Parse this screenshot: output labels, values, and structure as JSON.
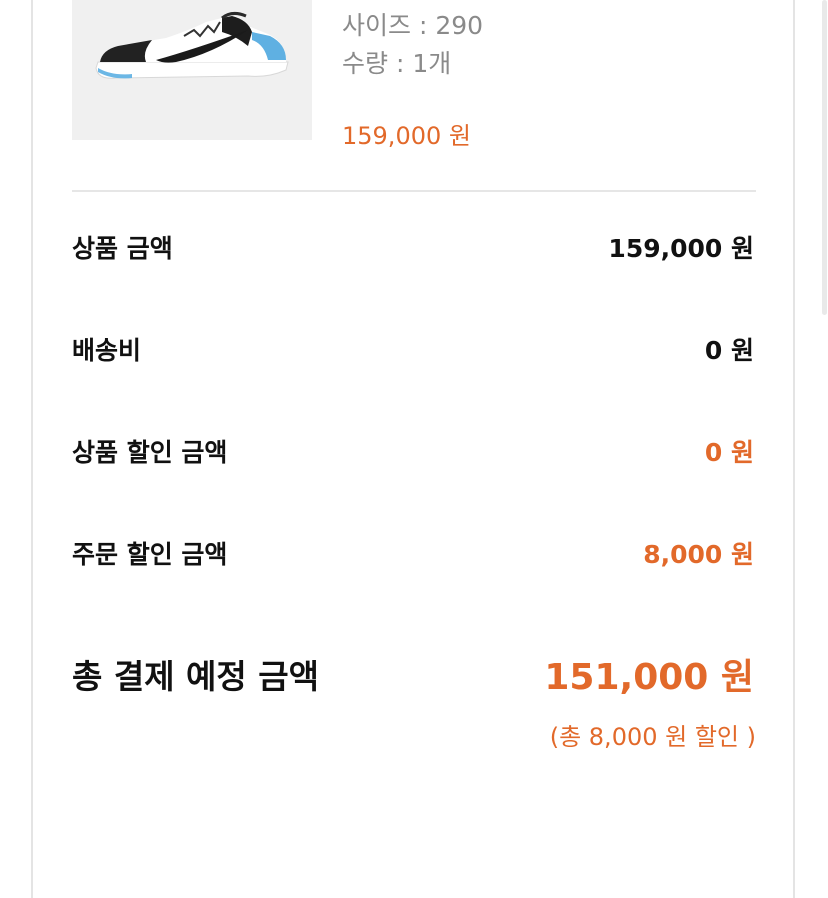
{
  "product": {
    "image_alt": "sneaker-image",
    "size_text": "사이즈 : 290",
    "qty_text": "수량 : 1개",
    "price": "159,000 원"
  },
  "summary": {
    "rows": [
      {
        "label": "상품 금액",
        "value": "159,000 원"
      },
      {
        "label": "배송비",
        "value": "0 원"
      },
      {
        "label": "상품 할인 금액",
        "value": "0 원"
      },
      {
        "label": "주문 할인 금액",
        "value": "8,000 원"
      }
    ],
    "total_label": "총 결제 예정 금액",
    "total_value": "151,000 원",
    "total_note": "(총 8,000 원 할인 )"
  },
  "colors": {
    "accent": "#e2692a",
    "text": "#111111",
    "muted": "#8a8a8a",
    "divider": "#e6e6e6"
  }
}
